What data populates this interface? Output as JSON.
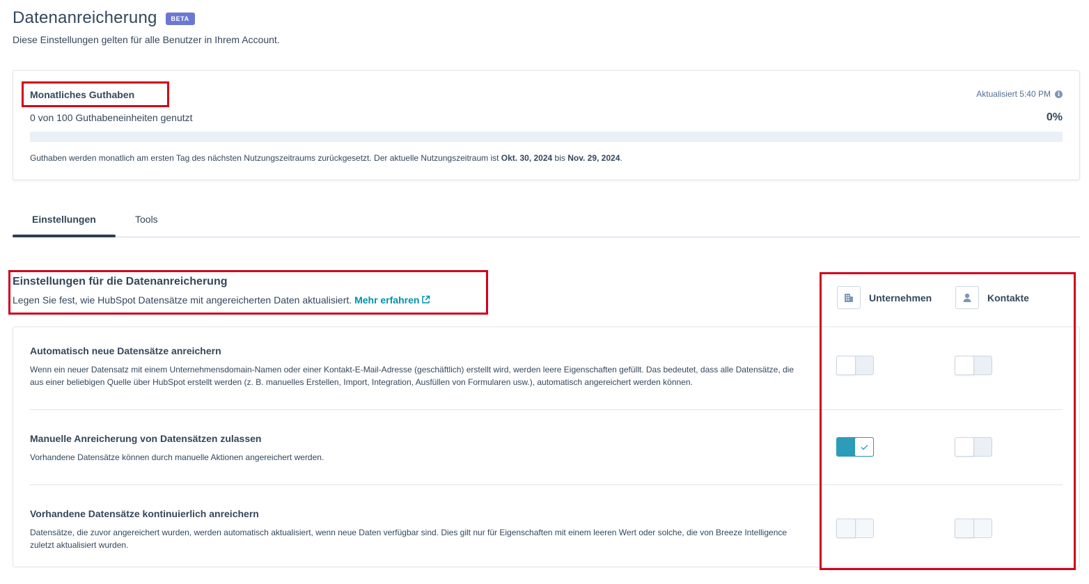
{
  "header": {
    "title": "Datenanreicherung",
    "badge": "BETA",
    "subtitle": "Diese Einstellungen gelten für alle Benutzer in Ihrem Account."
  },
  "credits": {
    "title": "Monatliches Guthaben",
    "updated": "Aktualisiert 5:40 PM",
    "used_text": "0 von 100 Guthabeneinheiten genutzt",
    "percent": "0%",
    "progress_fraction": 0,
    "note_prefix": "Guthaben werden monatlich am ersten Tag des nächsten Nutzungszeitraums zurückgesetzt. Der aktuelle Nutzungszeitraum ist ",
    "period_start": "Okt. 30, 2024",
    "note_between": " bis ",
    "period_end": "Nov. 29, 2024",
    "note_suffix": "."
  },
  "tabs": [
    {
      "label": "Einstellungen",
      "active": true
    },
    {
      "label": "Tools",
      "active": false
    }
  ],
  "settings": {
    "title": "Einstellungen für die Datenanreicherung",
    "description": "Legen Sie fest, wie HubSpot Datensätze mit angereicherten Daten aktualisiert.",
    "learn_more": "Mehr erfahren",
    "columns": [
      {
        "label": "Unternehmen",
        "icon": "building-icon"
      },
      {
        "label": "Kontakte",
        "icon": "person-icon"
      }
    ],
    "rows": [
      {
        "title": "Automatisch neue Datensätze anreichern",
        "description": "Wenn ein neuer Datensatz mit einem Unternehmensdomain-Namen oder einer Kontakt-E-Mail-Adresse (geschäftlich) erstellt wird, werden leere Eigenschaften gefüllt. Das bedeutet, dass alle Datensätze, die aus einer beliebigen Quelle über HubSpot erstellt werden (z. B. manuelles Erstellen, Import, Integration, Ausfüllen von Formularen usw.), automatisch angereichert werden können.",
        "companies": "off",
        "contacts": "off"
      },
      {
        "title": "Manuelle Anreicherung von Datensätzen zulassen",
        "description": "Vorhandene Datensätze können durch manuelle Aktionen angereichert werden.",
        "companies": "on",
        "contacts": "off"
      },
      {
        "title": "Vorhandene Datensätze kontinuierlich anreichern",
        "description": "Datensätze, die zuvor angereichert wurden, werden automatisch aktualisiert, wenn neue Daten verfügbar sind. Dies gilt nur für Eigenschaften mit einem leeren Wert oder solche, die von Breeze Intelligence zuletzt aktualisiert wurden.",
        "companies": "disabled",
        "contacts": "disabled"
      }
    ]
  },
  "colors": {
    "accent": "#2d9cb8",
    "link": "#0091ae",
    "text": "#33475b",
    "annotation": "#d0021b",
    "badge": "#6a78d1"
  }
}
